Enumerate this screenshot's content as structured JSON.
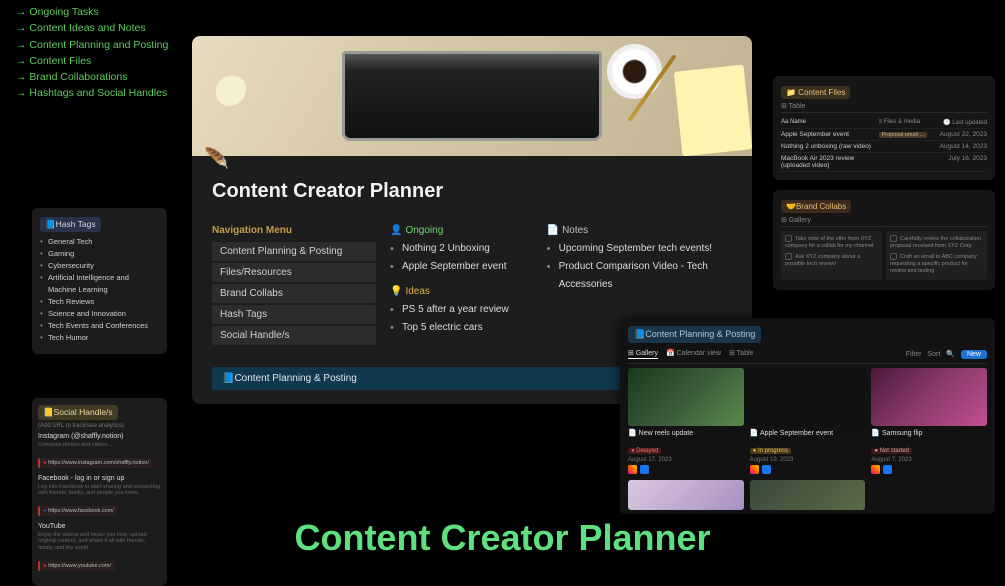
{
  "nav_links": {
    "items": [
      "Ongoing Tasks",
      "Content Ideas and Notes",
      "Content Planning and Posting",
      "Content Files",
      "Brand Collaborations",
      "Hashtags and Social Handles"
    ]
  },
  "hero": {
    "title": "Content Creator Planner",
    "nav_menu_header": "Navigation Menu",
    "nav_menu": [
      "Content Planning & Posting",
      "Files/Resources",
      "Brand Collabs",
      "Hash Tags",
      "Social Handle/s"
    ],
    "ongoing": {
      "label": "Ongoing",
      "items": [
        "Nothing 2 Unboxing",
        "Apple September event"
      ]
    },
    "ideas": {
      "label": "Ideas",
      "items": [
        "PS 5 after a year review",
        "Top 5 electric cars"
      ]
    },
    "notes": {
      "label": "Notes",
      "items": [
        "Upcoming September tech events!",
        "Product Comparison Video - Tech Accessories"
      ]
    },
    "banner": "📘Content Planning & Posting"
  },
  "hashtags": {
    "header": "📘Hash Tags",
    "items": [
      "General Tech",
      "Gaming",
      "Cybersecurity",
      "Artificial Intelligence and Machine Learning",
      "Tech Reviews",
      "Science and Innovation",
      "Tech Events and Conferences",
      "Tech Humor"
    ]
  },
  "social": {
    "header": "📒Social Handle/s",
    "sub": "(Add URL to track/see analytics)",
    "items": [
      {
        "title": "Instagram (@shaffly.notion)",
        "desc": "Compose photos and videos ...",
        "url": "https://www.instagram.com/shaffly.notion/"
      },
      {
        "title": "Facebook - log in or sign up",
        "desc": "Log into Facebook to start sharing and connecting with friends, family, and people you know.",
        "url": "https://www.facebook.com/"
      },
      {
        "title": "YouTube",
        "desc": "Enjoy the videos and music you love, upload original content, and share it all with friends, family, and the world.",
        "url": "https://www.youtube.com/"
      }
    ]
  },
  "content_files": {
    "header": "📁 Content Files",
    "tab": "⊞ Table",
    "cols": {
      "c1": "Aa Name",
      "c2": "≡ Files & media",
      "c3": "🕐 Last updated"
    },
    "rows": [
      {
        "name": "Apple September event",
        "files": "Proposal email ...",
        "date": "August 22, 2023"
      },
      {
        "name": "Nothing 2 unboxing (raw video)",
        "files": "",
        "date": "August 14, 2023"
      },
      {
        "name": "MacBook Air 2023 review (uploaded video)",
        "files": "",
        "date": "July 16, 2023"
      }
    ]
  },
  "brand_collabs": {
    "header": "🤝Brand Collabs",
    "tab": "⊞ Gallery",
    "cards": [
      {
        "t1": "Take note of the offer from XYZ company for a collab for my channel",
        "t2": "Ask XYZ company about a possible tech review/"
      },
      {
        "t1": "Carefully review the collaboration proposal received from XYZ Corp",
        "t2": "Craft an email to ABC company requesting a specific product for review and testing"
      }
    ]
  },
  "content_planning": {
    "header": "📘Content Planning & Posting",
    "views": {
      "gallery": "⊞ Gallery",
      "calendar": "📅 Calendar view",
      "table": "⊞ Table"
    },
    "toolbar": {
      "filter": "Filter",
      "sort": "Sort",
      "new": "New"
    },
    "cards": [
      {
        "title": "📄 New reels update",
        "status": "● Delayed",
        "status_class": "st-delayed",
        "date": "August 17, 2023"
      },
      {
        "title": "📄 Apple September event",
        "status": "● In progress",
        "status_class": "st-progress",
        "date": "August 19, 2023"
      },
      {
        "title": "📄 Samsung flip",
        "status": "● Not started",
        "status_class": "st-notstarted",
        "date": "August 7, 2023"
      }
    ]
  },
  "big_title": "Content Creator Planner"
}
